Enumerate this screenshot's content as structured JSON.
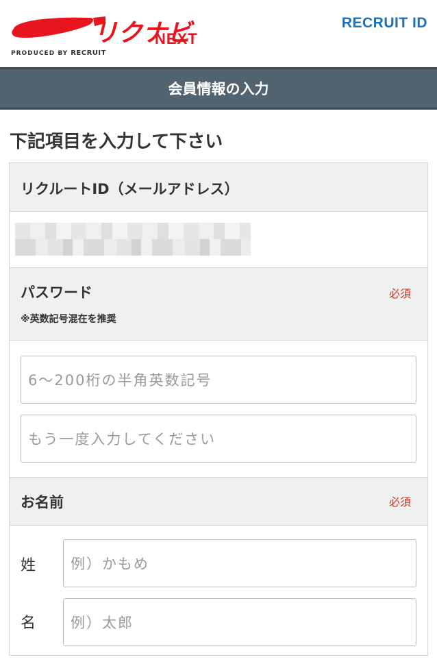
{
  "header": {
    "brand_name": "リクナビNEXT",
    "produced_by": "PRODUCED BY",
    "produced_by_company": "RECRUIT",
    "recruit_id_logo": "RECRUIT ID"
  },
  "title_bar": {
    "title": "会員情報の入力"
  },
  "instruction": "下記項目を入力して下さい",
  "sections": {
    "recruit_id": {
      "title": "リクルートID（メールアドレス）"
    },
    "password": {
      "title": "パスワード",
      "required": "必須",
      "note": "※英数記号混在を推奨",
      "placeholder": "6〜200桁の半角英数記号",
      "confirm_placeholder": "もう一度入力してください"
    },
    "name": {
      "title": "お名前",
      "required": "必須",
      "last_label": "姓",
      "last_placeholder": "例）かもめ",
      "first_label": "名",
      "first_placeholder": "例）太郎"
    }
  },
  "colors": {
    "title_bar": "#526470",
    "required": "#d0321e",
    "brand_red": "#e8141e",
    "recruit_blue": "#1f6fb5"
  }
}
